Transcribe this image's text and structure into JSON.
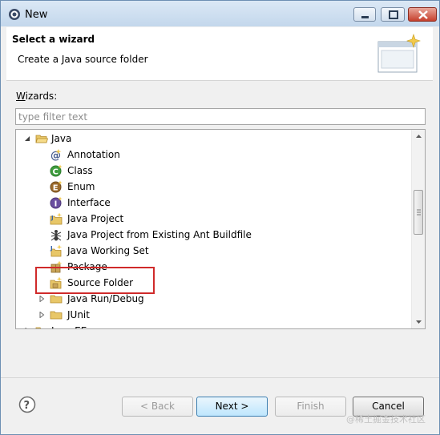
{
  "window": {
    "title": "New"
  },
  "header": {
    "title": "Select a wizard",
    "description": "Create a Java source folder"
  },
  "wizards_label": {
    "mnemonic": "W",
    "rest": "izards:"
  },
  "filter": {
    "placeholder": "type filter text",
    "value": ""
  },
  "tree": {
    "items": [
      {
        "label": "Java",
        "icon": "folder-open-icon",
        "expanded": true
      },
      {
        "label": "Annotation",
        "icon": "annotation-icon"
      },
      {
        "label": "Class",
        "icon": "class-icon"
      },
      {
        "label": "Enum",
        "icon": "enum-icon"
      },
      {
        "label": "Interface",
        "icon": "interface-icon"
      },
      {
        "label": "Java Project",
        "icon": "java-project-icon"
      },
      {
        "label": "Java Project from Existing Ant Buildfile",
        "icon": "ant-icon"
      },
      {
        "label": "Java Working Set",
        "icon": "working-set-icon"
      },
      {
        "label": "Package",
        "icon": "package-icon"
      },
      {
        "label": "Source Folder",
        "icon": "source-folder-icon",
        "selected": true
      },
      {
        "label": "Java Run/Debug",
        "icon": "folder-icon",
        "expanded": false
      },
      {
        "label": "JUnit",
        "icon": "folder-icon",
        "expanded": false
      },
      {
        "label": "Java EE",
        "icon": "folder-icon",
        "expanded": false
      }
    ]
  },
  "buttons": {
    "back": "< Back",
    "next": "Next >",
    "finish": "Finish",
    "cancel": "Cancel"
  },
  "watermark": "@稀土掘金技术社区",
  "colors": {
    "highlight": "#d02a2a",
    "default_button": "#3c7fb1",
    "title_bar": "#c3d7ec"
  }
}
